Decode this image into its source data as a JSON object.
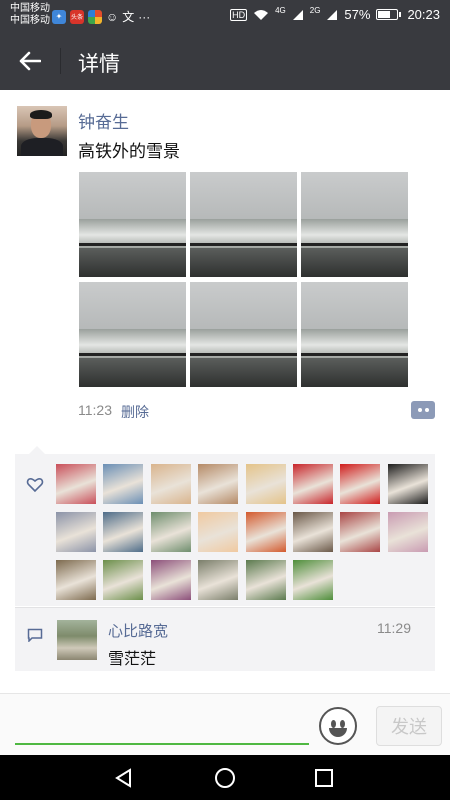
{
  "status_bar": {
    "carrier_1": "中国移动",
    "carrier_2": "中国移动",
    "app_icons": [
      {
        "name": "app-icon-blue",
        "color": "#3f86d9"
      },
      {
        "name": "app-icon-toutiao",
        "color": "#d8342a",
        "label": "头条"
      },
      {
        "name": "app-icon-multicolor",
        "color": "#e44d2a"
      }
    ],
    "more_dots": "···",
    "hd_label": "HD",
    "network_1": "4G",
    "network_2": "2G",
    "battery_percent": "57%",
    "battery_level": 0.57,
    "time": "20:23"
  },
  "titlebar": {
    "title": "详情",
    "back_icon": "arrow-left-icon"
  },
  "post": {
    "author": "钟奋生",
    "text": "高铁外的雪景",
    "time": "11:23",
    "delete_label": "删除",
    "photo_count": 6
  },
  "likes": {
    "icon": "heart-icon",
    "avatar_colors": [
      "#c94f5a",
      "#6a8fb5",
      "#d9b48d",
      "#b58a66",
      "#e4c389",
      "#c8252b",
      "#d01c1c",
      "#1d1d1d",
      "#8b93a8",
      "#4e6c89",
      "#6e8e6d",
      "#f0c9a0",
      "#d35a2e",
      "#6a5848",
      "#a94545",
      "#c99bb2",
      "#7d6a4e",
      "#6b8f4a",
      "#8c4f7a",
      "#7a7e6a",
      "#5b7a4e",
      "#4e8e3a"
    ]
  },
  "comment": {
    "icon": "comment-bubble-icon",
    "name": "心比路宽",
    "time": "11:29",
    "text": "雪茫茫"
  },
  "input_bar": {
    "emoji_icon": "smiley-icon",
    "send_label": "发送",
    "accent": "#4fb842"
  },
  "nav_bar": {
    "back_icon": "triangle-back-icon",
    "home_icon": "circle-home-icon",
    "recent_icon": "square-recent-icon"
  }
}
